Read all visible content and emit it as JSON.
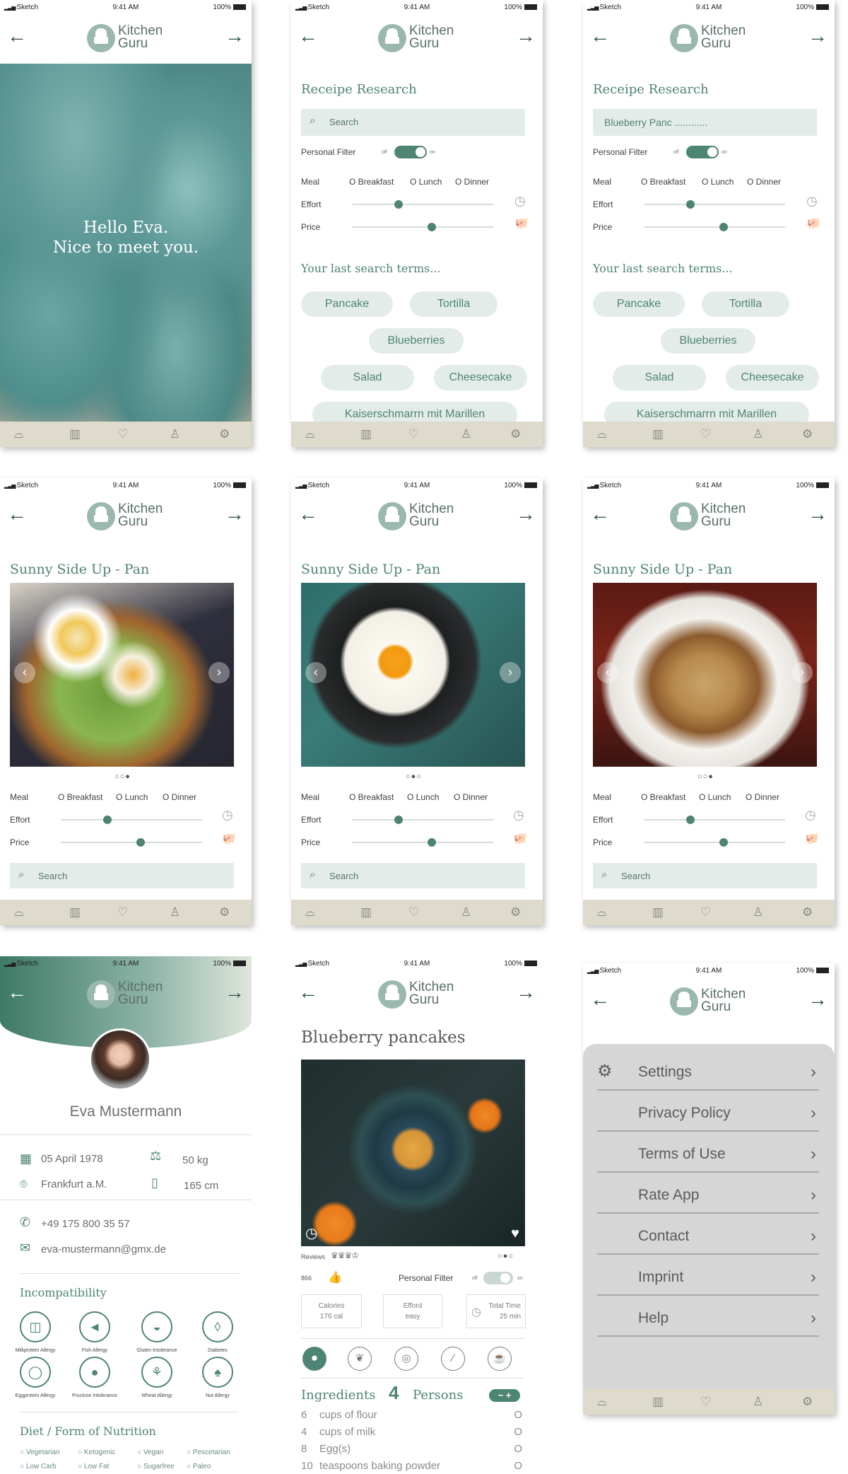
{
  "status": {
    "carrier": "Sketch",
    "time": "9:41 AM",
    "battery": "100%"
  },
  "app": {
    "logo_line1": "Kitchen",
    "logo_line2": "Guru"
  },
  "colors": {
    "accent": "#4e8474",
    "tabbar": "#dedbcc",
    "field": "#e3ece9"
  },
  "icons": {
    "back": "←",
    "forward": "→",
    "tabs": [
      "cloche-icon",
      "trash-icon",
      "heart-icon",
      "user-icon",
      "gear-icon"
    ]
  },
  "welcome": {
    "line1": "Hello Eva.",
    "line2": "Nice to meet you."
  },
  "research": {
    "title": "Receipe Research",
    "search_placeholder": "Search",
    "search_value": "Blueberry Panc ............",
    "personal_filter": "Personal Filter",
    "off": "off",
    "on": "on",
    "meal_label": "Meal",
    "meal_options": [
      "O Breakfast",
      "O Lunch",
      "O Dinner"
    ],
    "effort_label": "Effort",
    "effort_level": 0.32,
    "price_label": "Price",
    "price_level": 0.57,
    "last_search_title": "Your last search terms...",
    "chips": [
      "Pancake",
      "Tortilla",
      "Blueberries",
      "Salad",
      "Cheesecake",
      "Kaiserschmarrn mit Marillen"
    ]
  },
  "recipe_view": {
    "title": "Sunny Side Up - Pan",
    "pager": [
      "○○●",
      "○●○",
      "○○●"
    ],
    "search_placeholder": "Search"
  },
  "profile": {
    "name": "Eva Mustermann",
    "birthday": "05 April 1978",
    "city": "Frankfurt a.M.",
    "weight": "50 kg",
    "height": "165 cm",
    "phone": "+49 175 800 35 57",
    "email": "eva-mustermann@gmx.de",
    "incompatibility_title": "Incompatibility",
    "allergies": [
      "Milkprotein Allergy",
      "Fish Allergy",
      "Gluten Intolerance",
      "Diabetes",
      "Eggprotein Allergy",
      "Fructose Intolerance",
      "Wheat Allergy",
      "Nut Allergy"
    ],
    "diet_title": "Diet / Form of Nutrition",
    "diets_row1": [
      "○ Vegetarian",
      "○ Ketogenic",
      "○ Vegan",
      "○ Pescetarian"
    ],
    "diets_row2": [
      "○ Low Carb",
      "○ Low Fat",
      "○ Sugarfree",
      "○ Paleo"
    ]
  },
  "pancakes": {
    "title": "Blueberry pancakes",
    "reviews": "Reviews",
    "likes": "866",
    "personal_filter": "Personal Filter",
    "pager": "○●○",
    "calories_label": "Calories",
    "calories_value": "176 cal",
    "effort_label": "Efford",
    "effort_value": "easy",
    "time_label": "Total Time",
    "time_value": "25 min",
    "ingredients_title": "Ingredients",
    "persons_count": "4",
    "persons_label": "Persons",
    "stepper": "− +",
    "ingredients": [
      {
        "qty": "6",
        "name": "cups of flour",
        "mark": "O"
      },
      {
        "qty": "4",
        "name": "cups of milk",
        "mark": "O"
      },
      {
        "qty": "8",
        "name": "Egg(s)",
        "mark": "O"
      },
      {
        "qty": "10",
        "name": "teaspoons baking powder",
        "mark": "O"
      }
    ]
  },
  "settings": {
    "items": [
      "Settings",
      "Privacy Policy",
      "Terms of Use",
      "Rate App",
      "Contact",
      "Imprint",
      "Help"
    ]
  }
}
